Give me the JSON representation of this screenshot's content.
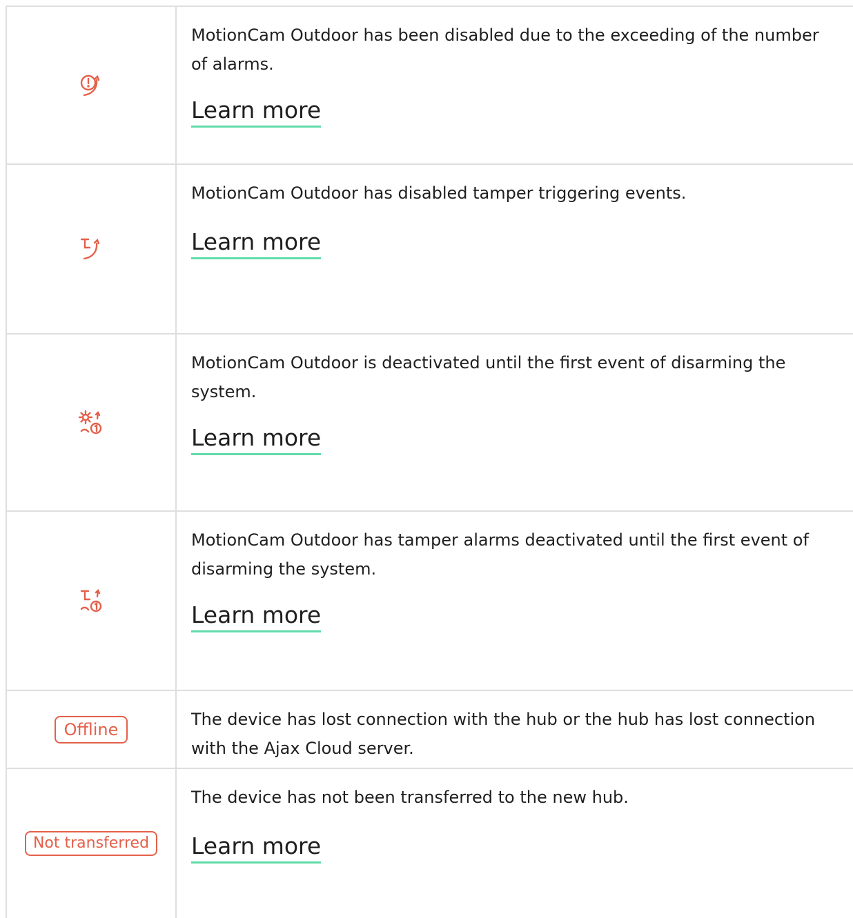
{
  "colors": {
    "accent": "#e4604a",
    "link_underline": "#5fdba8",
    "border": "#dedede",
    "text": "#1f1f1f"
  },
  "rows": [
    {
      "icon": "alarm-exceeded-icon",
      "text": "MotionCam Outdoor has been disabled due to the exceeding of the number of alarms.",
      "link": "Learn more"
    },
    {
      "icon": "tamper-disabled-icon",
      "text": "MotionCam Outdoor has disabled tamper triggering events.",
      "link": "Learn more"
    },
    {
      "icon": "gear-once-icon",
      "text": "MotionCam Outdoor is deactivated until the first event of disarming the system.",
      "link": "Learn more"
    },
    {
      "icon": "tamper-once-icon",
      "text": "MotionCam Outdoor has tamper alarms deactivated until the first event of disarming the system.",
      "link": "Learn more"
    },
    {
      "badge": "Offline",
      "text": "The device has lost connection with the hub or the hub has lost connection with the Ajax Cloud server."
    },
    {
      "badge": "Not transferred",
      "text": "The device has not been transferred to the new hub.",
      "link": "Learn more"
    }
  ]
}
